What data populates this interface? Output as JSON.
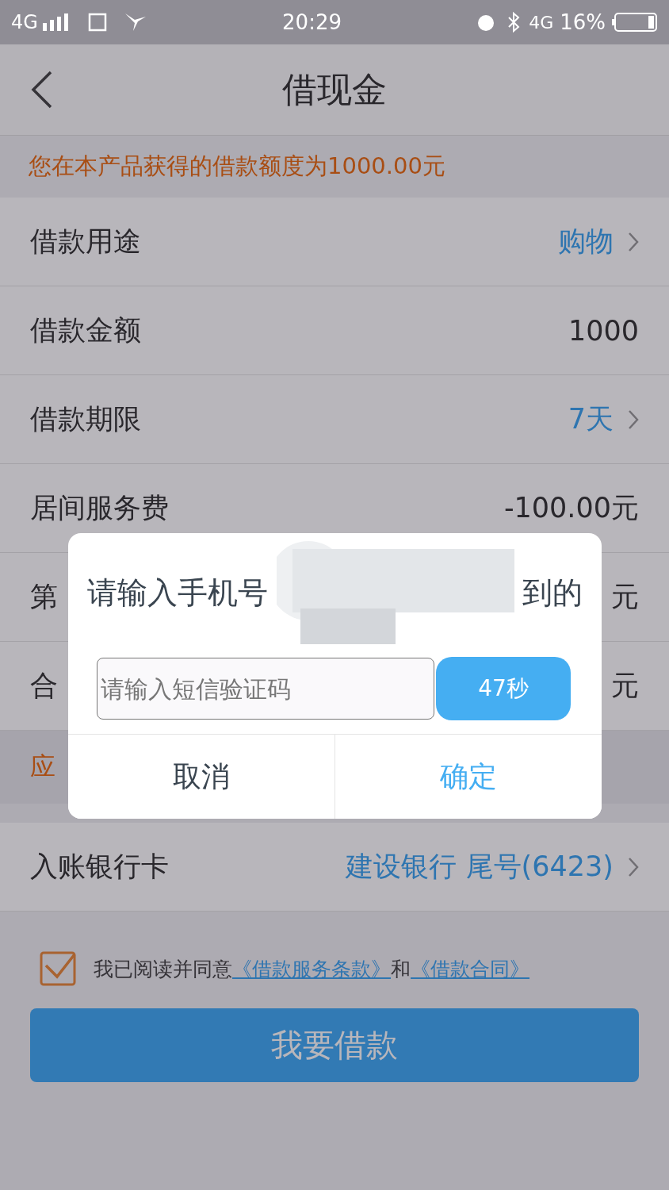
{
  "status_bar": {
    "network": "4G",
    "time": "20:29",
    "network_2": "4G",
    "battery": "16%"
  },
  "header": {
    "title": "借现金"
  },
  "notice": "您在本产品获得的借款额度为1000.00元",
  "rows": [
    {
      "kind": "link",
      "label": "借款用途",
      "value": "购物"
    },
    {
      "kind": "plain",
      "label": "借款金额",
      "value": "1000"
    },
    {
      "kind": "link",
      "label": "借款期限",
      "value": "7天"
    },
    {
      "kind": "plain",
      "label": "居间服务费",
      "value": "-100.00元"
    },
    {
      "kind": "plain",
      "label": "第",
      "value": "元"
    },
    {
      "kind": "plain",
      "label": "合",
      "value": "元"
    }
  ],
  "due": {
    "label": "应"
  },
  "bank_row": {
    "label": "入账银行卡",
    "value": "建设银行 尾号(6423)"
  },
  "agreement": {
    "checked": true,
    "text": "我已阅读并同意",
    "links": [
      "《借款服务条款》",
      "《借款合同》"
    ],
    "joiner": "和"
  },
  "submit": "我要借款",
  "dialog": {
    "title_start": "请输入手机号",
    "title_end": "到的",
    "code_field": {
      "placeholder": "请输入短信验证码"
    },
    "countdown": "47秒",
    "buttons": [
      {
        "label": "取消",
        "kind": "cancel"
      },
      {
        "label": "确定",
        "kind": "confirm"
      }
    ]
  }
}
